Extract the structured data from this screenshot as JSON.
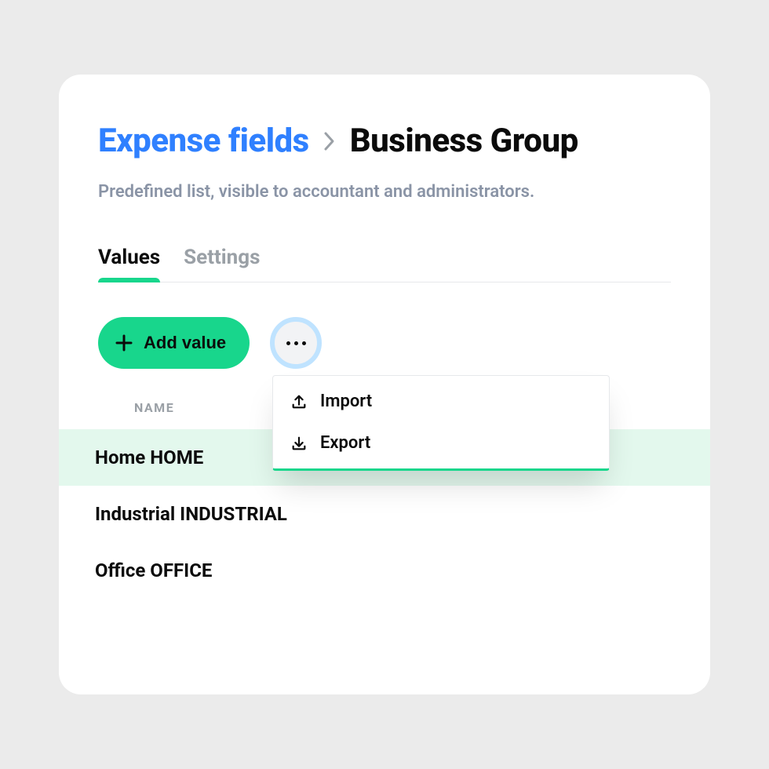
{
  "breadcrumb": {
    "root": "Expense fields",
    "current": "Business Group"
  },
  "description": "Predefined list, visible to accountant and administrators.",
  "tabs": [
    {
      "label": "Values",
      "active": true
    },
    {
      "label": "Settings",
      "active": false
    }
  ],
  "toolbar": {
    "add_label": "Add value"
  },
  "menu": {
    "import_label": "Import",
    "export_label": "Export"
  },
  "table": {
    "column_header": "NAME",
    "rows": [
      {
        "label": "Home HOME",
        "highlight": true
      },
      {
        "label": "Industrial INDUSTRIAL",
        "highlight": false
      },
      {
        "label": "Office OFFICE",
        "highlight": false
      }
    ]
  }
}
